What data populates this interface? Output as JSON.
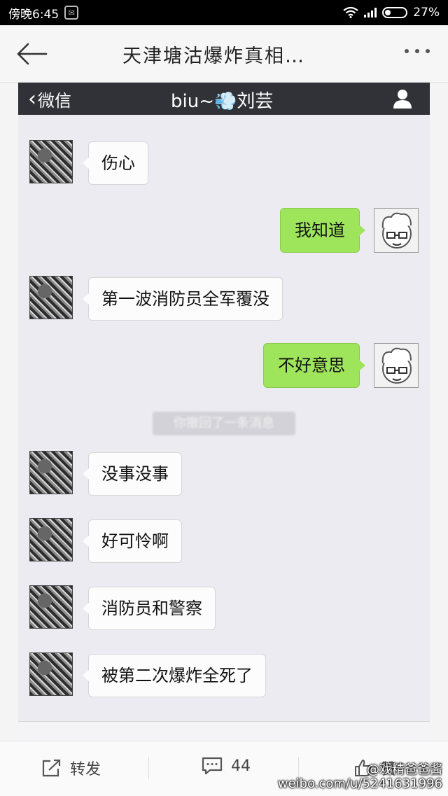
{
  "status_bar": {
    "time": "傍晚6:45",
    "battery": "27%",
    "battery_level": 0.27
  },
  "app_bar": {
    "title": "天津塘沽爆炸真相…"
  },
  "embedded": {
    "header": {
      "back_label": "微信",
      "chat_title": "biu~💨刘芸"
    },
    "messages": [
      {
        "side": "left",
        "text": "伤心"
      },
      {
        "side": "right",
        "text": "我知道"
      },
      {
        "side": "left",
        "text": "第一波消防员全军覆没"
      },
      {
        "side": "right",
        "text": "不好意思"
      },
      {
        "side": "system",
        "text": "你撤回了一条消息"
      },
      {
        "side": "left",
        "text": "没事没事"
      },
      {
        "side": "left",
        "text": "好可怜啊"
      },
      {
        "side": "left",
        "text": "消防员和警察"
      },
      {
        "side": "left",
        "text": "被第二次爆炸全死了"
      }
    ]
  },
  "bottom_bar": {
    "repost_label": "转发",
    "comment_count": "44",
    "like_label": "赞"
  },
  "watermark": {
    "line1": "@戏精爸爸酱",
    "line2": "weibo.com/u/5241631996"
  }
}
